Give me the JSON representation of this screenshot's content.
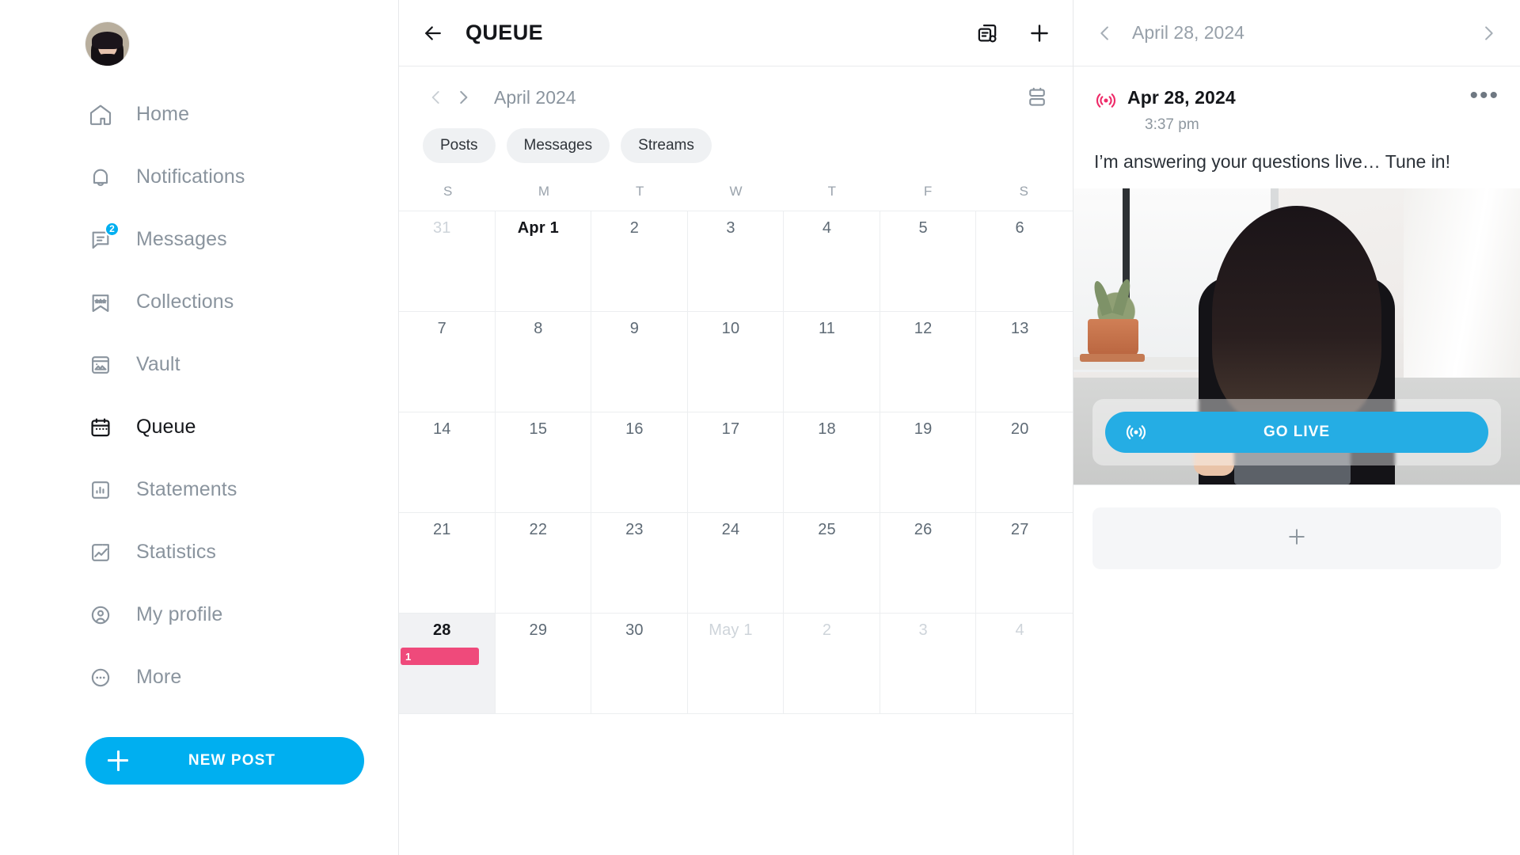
{
  "sidebar": {
    "avatar_name": "user-avatar",
    "items": [
      {
        "label": "Home",
        "icon": "home-icon",
        "active": false,
        "badge": null
      },
      {
        "label": "Notifications",
        "icon": "bell-icon",
        "active": false,
        "badge": null
      },
      {
        "label": "Messages",
        "icon": "messages-icon",
        "active": false,
        "badge": "2"
      },
      {
        "label": "Collections",
        "icon": "bookmark-star-icon",
        "active": false,
        "badge": null
      },
      {
        "label": "Vault",
        "icon": "vault-image-icon",
        "active": false,
        "badge": null
      },
      {
        "label": "Queue",
        "icon": "calendar-icon",
        "active": true,
        "badge": null
      },
      {
        "label": "Statements",
        "icon": "bar-chart-icon",
        "active": false,
        "badge": null
      },
      {
        "label": "Statistics",
        "icon": "trend-up-icon",
        "active": false,
        "badge": null
      },
      {
        "label": "My profile",
        "icon": "user-circle-icon",
        "active": false,
        "badge": null
      },
      {
        "label": "More",
        "icon": "ellipsis-circle-icon",
        "active": false,
        "badge": null
      }
    ],
    "new_post_label": "NEW POST"
  },
  "queue": {
    "title": "QUEUE",
    "back_icon": "back-arrow-icon",
    "header_icons": [
      "queue-settings-icon",
      "plus-icon"
    ],
    "month_label": "April 2024",
    "prev_icon": "chevron-left-icon",
    "next_icon": "chevron-right-icon",
    "layout_toggle_icon": "layout-rows-icon",
    "chips": [
      "Posts",
      "Messages",
      "Streams"
    ],
    "weekdays": [
      "S",
      "M",
      "T",
      "W",
      "T",
      "F",
      "S"
    ],
    "days": [
      {
        "label": "31",
        "muted": true,
        "selected": false,
        "first": false,
        "events": []
      },
      {
        "label": "Apr 1",
        "muted": false,
        "selected": false,
        "first": true,
        "events": []
      },
      {
        "label": "2",
        "muted": false,
        "selected": false,
        "first": false,
        "events": []
      },
      {
        "label": "3",
        "muted": false,
        "selected": false,
        "first": false,
        "events": []
      },
      {
        "label": "4",
        "muted": false,
        "selected": false,
        "first": false,
        "events": []
      },
      {
        "label": "5",
        "muted": false,
        "selected": false,
        "first": false,
        "events": []
      },
      {
        "label": "6",
        "muted": false,
        "selected": false,
        "first": false,
        "events": []
      },
      {
        "label": "7",
        "muted": false,
        "selected": false,
        "first": false,
        "events": []
      },
      {
        "label": "8",
        "muted": false,
        "selected": false,
        "first": false,
        "events": []
      },
      {
        "label": "9",
        "muted": false,
        "selected": false,
        "first": false,
        "events": []
      },
      {
        "label": "10",
        "muted": false,
        "selected": false,
        "first": false,
        "events": []
      },
      {
        "label": "11",
        "muted": false,
        "selected": false,
        "first": false,
        "events": []
      },
      {
        "label": "12",
        "muted": false,
        "selected": false,
        "first": false,
        "events": []
      },
      {
        "label": "13",
        "muted": false,
        "selected": false,
        "first": false,
        "events": []
      },
      {
        "label": "14",
        "muted": false,
        "selected": false,
        "first": false,
        "events": []
      },
      {
        "label": "15",
        "muted": false,
        "selected": false,
        "first": false,
        "events": []
      },
      {
        "label": "16",
        "muted": false,
        "selected": false,
        "first": false,
        "events": []
      },
      {
        "label": "17",
        "muted": false,
        "selected": false,
        "first": false,
        "events": []
      },
      {
        "label": "18",
        "muted": false,
        "selected": false,
        "first": false,
        "events": []
      },
      {
        "label": "19",
        "muted": false,
        "selected": false,
        "first": false,
        "events": []
      },
      {
        "label": "20",
        "muted": false,
        "selected": false,
        "first": false,
        "events": []
      },
      {
        "label": "21",
        "muted": false,
        "selected": false,
        "first": false,
        "events": []
      },
      {
        "label": "22",
        "muted": false,
        "selected": false,
        "first": false,
        "events": []
      },
      {
        "label": "23",
        "muted": false,
        "selected": false,
        "first": false,
        "events": []
      },
      {
        "label": "24",
        "muted": false,
        "selected": false,
        "first": false,
        "events": []
      },
      {
        "label": "25",
        "muted": false,
        "selected": false,
        "first": false,
        "events": []
      },
      {
        "label": "26",
        "muted": false,
        "selected": false,
        "first": false,
        "events": []
      },
      {
        "label": "27",
        "muted": false,
        "selected": false,
        "first": false,
        "events": []
      },
      {
        "label": "28",
        "muted": false,
        "selected": true,
        "first": false,
        "events": [
          {
            "count": "1",
            "color": "#ef4a7b"
          }
        ]
      },
      {
        "label": "29",
        "muted": false,
        "selected": false,
        "first": false,
        "events": []
      },
      {
        "label": "30",
        "muted": false,
        "selected": false,
        "first": false,
        "events": []
      },
      {
        "label": "May 1",
        "muted": true,
        "selected": false,
        "first": false,
        "events": []
      },
      {
        "label": "2",
        "muted": true,
        "selected": false,
        "first": false,
        "events": []
      },
      {
        "label": "3",
        "muted": true,
        "selected": false,
        "first": false,
        "events": []
      },
      {
        "label": "4",
        "muted": true,
        "selected": false,
        "first": false,
        "events": []
      }
    ]
  },
  "detail": {
    "header_date": "April 28, 2024",
    "prev_icon": "chevron-left-icon",
    "next_icon": "chevron-right-icon",
    "post": {
      "type_icon": "live-broadcast-icon",
      "date": "Apr 28, 2024",
      "time": "3:37 pm",
      "more_icon": "ellipsis-icon",
      "text": "I’m answering your questions live… Tune in!",
      "media_alt": "woman-sitting-by-window-photo",
      "cta_label": "GO LIVE",
      "cta_icon": "live-broadcast-icon"
    },
    "add_slot_icon": "plus-icon"
  },
  "colors": {
    "accent_blue": "#00aff0",
    "cta_blue": "#25ade4",
    "event_pink": "#ef4a7b",
    "live_pink": "#ee2a68",
    "text_muted": "#8a949e",
    "text_dark": "#14161a",
    "border": "#e9ebed"
  }
}
